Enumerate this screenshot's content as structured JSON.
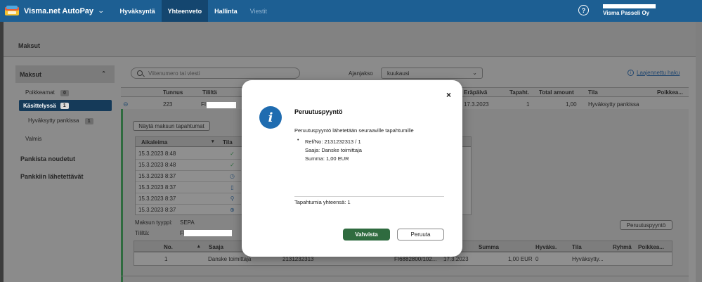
{
  "app": {
    "title": "Visma.net AutoPay",
    "company": "Visma Passeli Oy"
  },
  "nav": [
    "Hyväksyntä",
    "Yhteenveto",
    "Hallinta",
    "Viestit"
  ],
  "page": {
    "title": "Maksut"
  },
  "sidebar": {
    "section": "Maksut",
    "items": [
      {
        "label": "Poikkeamat",
        "count": "0"
      },
      {
        "label": "Käsittelyssä",
        "count": "1"
      },
      {
        "label": "Hyväksytty pankissa",
        "count": "1"
      },
      {
        "label": "Valmis"
      }
    ],
    "sections": [
      "Pankista noudetut",
      "Pankkiin lähetettävät"
    ]
  },
  "filters": {
    "search_placeholder": "Viitenumero tai viesti",
    "period_label": "Ajanjakso",
    "period_value": "kuukausi",
    "advanced_search": "Laajennettu haku"
  },
  "table": {
    "headers": [
      "Tunnus",
      "Tililtä",
      "Eräpäivä",
      "Tapaht.",
      "Total amount",
      "Tila",
      "Poikkea..."
    ],
    "row": {
      "id": "223",
      "account_prefix": "FI",
      "due_date": "17.3.2023",
      "events": "1",
      "total": "1,00",
      "status": "Hyväksytty pankissa"
    }
  },
  "details": {
    "show_events_button": "Näytä maksun tapahtumat",
    "events_headers": [
      "Aikaleima",
      "Tila"
    ],
    "events": [
      "15.3.2023 8:48",
      "15.3.2023 8:48",
      "15.3.2023 8:37",
      "15.3.2023 8:37",
      "15.3.2023 8:37",
      "15.3.2023 8:37"
    ],
    "payment_type_label": "Maksun tyyppi:",
    "payment_type_value": "SEPA",
    "account_label": "Tililtä:",
    "account_prefix": "FI",
    "cancel_request_button": "Peruutuspyyntö"
  },
  "lower_table": {
    "headers": [
      "No.",
      "Saaja",
      "Summa",
      "Hyväks.",
      "Tila",
      "Ryhmä",
      "Poikkea..."
    ],
    "row": {
      "no": "1",
      "recipient": "Danske toimittaja",
      "ref": "2131232313",
      "iban_partial": "FI6882800/102...",
      "date": "17.3.2023",
      "amount": "1,00 EUR",
      "approvals": "0",
      "status": "Hyväksytty..."
    }
  },
  "modal": {
    "title": "Peruutuspyyntö",
    "intro": "Peruutuspyyntö lähetetään seuraaville tapahtumille",
    "ref_line": "Ref/No: 2131232313 / 1",
    "recipient_line": "Saaja: Danske toimittaja",
    "amount_line": "Summa: 1,00 EUR",
    "total_line": "Tapahtumia yhteensä: 1",
    "confirm": "Vahvista",
    "cancel": "Peruuta",
    "close": "×"
  },
  "colors": {
    "topbar": "#1d5f93",
    "topbar_active": "#14466f",
    "confirm": "#2f6b3f",
    "info": "#1f6cb0"
  },
  "icons": [
    "visma-logo-icon",
    "chevron-down-icon",
    "help-icon",
    "chevron-up-icon",
    "search-icon",
    "info-icon",
    "close-icon",
    "collapse-icon",
    "check-circle-icon",
    "clock-icon",
    "document-icon",
    "user-check-icon",
    "plus-circle-icon",
    "sort-icon"
  ]
}
